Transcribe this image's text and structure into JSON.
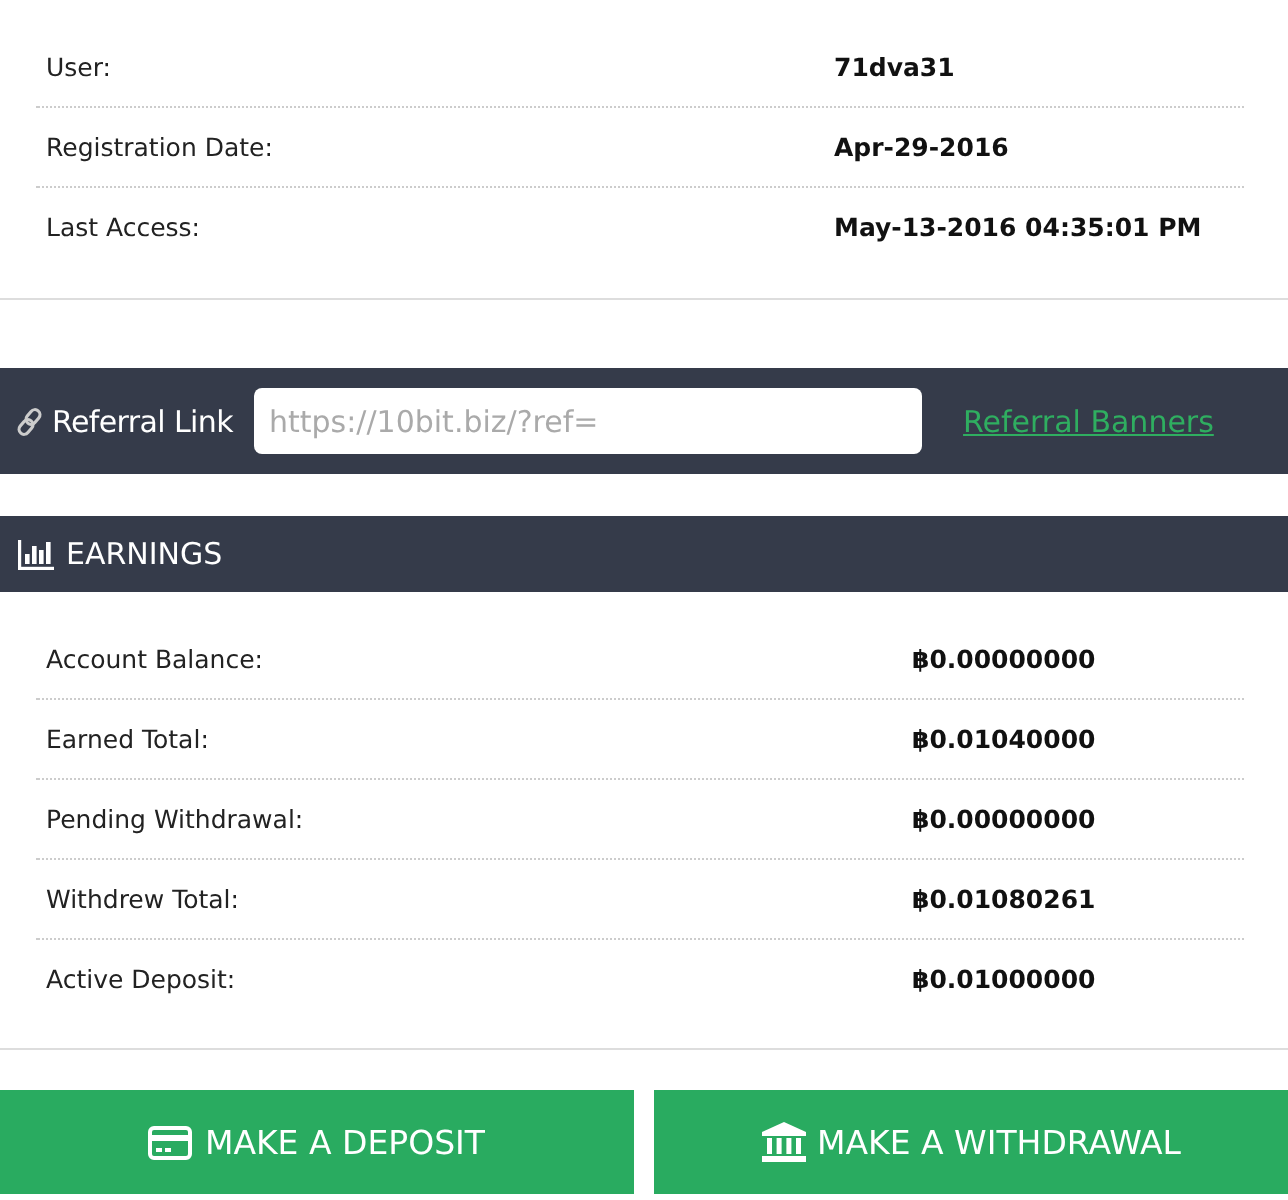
{
  "account": [
    {
      "label": "User:",
      "value": "71dva31"
    },
    {
      "label": "Registration Date:",
      "value": "Apr-29-2016"
    },
    {
      "label": "Last Access:",
      "value": "May-13-2016 04:35:01 PM"
    }
  ],
  "referral": {
    "label": "Referral Link",
    "placeholder": "https://10bit.biz/?ref=",
    "link": "Referral Banners"
  },
  "earnings": {
    "title": "EARNINGS",
    "rows": [
      {
        "label": "Account Balance:",
        "value": "฿0.00000000"
      },
      {
        "label": "Earned Total:",
        "value": "฿0.01040000"
      },
      {
        "label": "Pending Withdrawal:",
        "value": "฿0.00000000"
      },
      {
        "label": "Withdrew Total:",
        "value": "฿0.01080261"
      },
      {
        "label": "Active Deposit:",
        "value": "฿0.01000000"
      }
    ]
  },
  "buttons": [
    {
      "kind": "deposit",
      "label": "MAKE A DEPOSIT"
    },
    {
      "kind": "withdrawal",
      "label": "MAKE A WITHDRAWAL"
    }
  ]
}
